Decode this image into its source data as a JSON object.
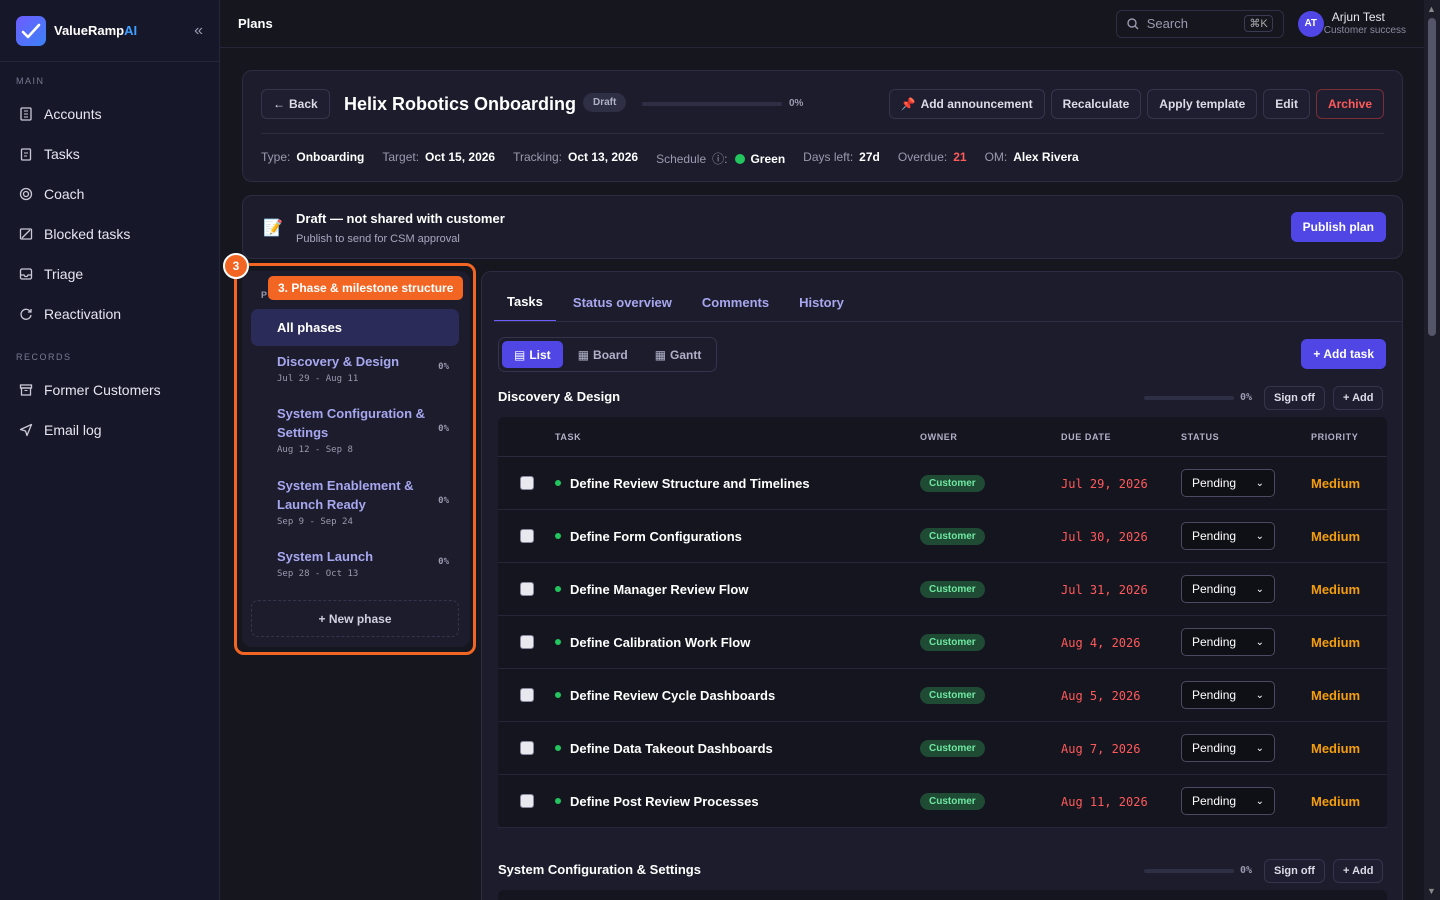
{
  "brand": {
    "name": "ValueRamp",
    "suffix": "AI"
  },
  "sidebar": {
    "main_label": "MAIN",
    "main_items": [
      {
        "label": "Accounts",
        "icon": "building-icon"
      },
      {
        "label": "Tasks",
        "icon": "clipboard-icon"
      },
      {
        "label": "Coach",
        "icon": "target-icon"
      },
      {
        "label": "Blocked tasks",
        "icon": "blocked-icon"
      },
      {
        "label": "Triage",
        "icon": "inbox-icon"
      },
      {
        "label": "Reactivation",
        "icon": "refresh-icon"
      }
    ],
    "records_label": "RECORDS",
    "records_items": [
      {
        "label": "Former Customers",
        "icon": "archive-icon"
      },
      {
        "label": "Email log",
        "icon": "send-icon"
      }
    ]
  },
  "topbar": {
    "title": "Plans",
    "search_placeholder": "Search",
    "search_shortcut": "⌘K",
    "user_initials": "AT",
    "user_name": "Arjun Test",
    "user_role": "Customer success"
  },
  "plan": {
    "back_label": "Back",
    "title": "Helix Robotics Onboarding",
    "status": "Draft",
    "progress": 0,
    "progress_label": "0%",
    "actions": {
      "announce": "Add announcement",
      "recalculate": "Recalculate",
      "apply_template": "Apply template",
      "edit": "Edit",
      "archive": "Archive"
    },
    "meta": {
      "type_label": "Type:",
      "type": "Onboarding",
      "target_label": "Target:",
      "target": "Oct 15, 2026",
      "tracking_label": "Tracking:",
      "tracking": "Oct 13, 2026",
      "schedule_label": "Schedule",
      "schedule": "Green",
      "days_left_label": "Days left:",
      "days_left": "27d",
      "overdue_label": "Overdue:",
      "overdue": "21",
      "om_label": "OM:",
      "om": "Alex Rivera"
    }
  },
  "draft_banner": {
    "title": "Draft — not shared with customer",
    "subtitle": "Publish to send for CSM approval",
    "publish_label": "Publish plan"
  },
  "callout": {
    "number": "3",
    "label": "3. Phase & milestone structure"
  },
  "phases": {
    "header_initial": "P",
    "all_label": "All phases",
    "items": [
      {
        "name": "Discovery & Design",
        "dates": "Jul 29 - Aug 11",
        "pct": "0%"
      },
      {
        "name": "System Configuration & Settings",
        "dates": "Aug 12 - Sep 8",
        "pct": "0%"
      },
      {
        "name": "System Enablement & Launch Ready",
        "dates": "Sep 9 - Sep 24",
        "pct": "0%"
      },
      {
        "name": "System Launch",
        "dates": "Sep 28 - Oct 13",
        "pct": "0%"
      }
    ],
    "new_label": "+ New phase"
  },
  "tabs": [
    "Tasks",
    "Status overview",
    "Comments",
    "History"
  ],
  "views": {
    "list": "List",
    "board": "Board",
    "gantt": "Gantt"
  },
  "add_task_label": "+ Add task",
  "columns": {
    "task": "TASK",
    "owner": "OWNER",
    "due": "DUE DATE",
    "status": "STATUS",
    "priority": "PRIORITY"
  },
  "groups": [
    {
      "title": "Discovery & Design",
      "pct": "0%",
      "sign_off": "Sign off",
      "add": "+ Add",
      "tasks": [
        {
          "name": "Define Review Structure and Timelines",
          "owner": "Customer",
          "due": "Jul 29, 2026",
          "status": "Pending",
          "priority": "Medium"
        },
        {
          "name": "Define Form Configurations",
          "owner": "Customer",
          "due": "Jul 30, 2026",
          "status": "Pending",
          "priority": "Medium"
        },
        {
          "name": "Define Manager Review Flow",
          "owner": "Customer",
          "due": "Jul 31, 2026",
          "status": "Pending",
          "priority": "Medium"
        },
        {
          "name": "Define Calibration Work Flow",
          "owner": "Customer",
          "due": "Aug 4, 2026",
          "status": "Pending",
          "priority": "Medium"
        },
        {
          "name": "Define Review Cycle Dashboards",
          "owner": "Customer",
          "due": "Aug 5, 2026",
          "status": "Pending",
          "priority": "Medium"
        },
        {
          "name": "Define Data Takeout Dashboards",
          "owner": "Customer",
          "due": "Aug 7, 2026",
          "status": "Pending",
          "priority": "Medium"
        },
        {
          "name": "Define Post Review Processes",
          "owner": "Customer",
          "due": "Aug 11, 2026",
          "status": "Pending",
          "priority": "Medium"
        }
      ]
    },
    {
      "title": "System Configuration & Settings",
      "pct": "0%",
      "sign_off": "Sign off",
      "add": "+ Add",
      "tasks": []
    }
  ]
}
